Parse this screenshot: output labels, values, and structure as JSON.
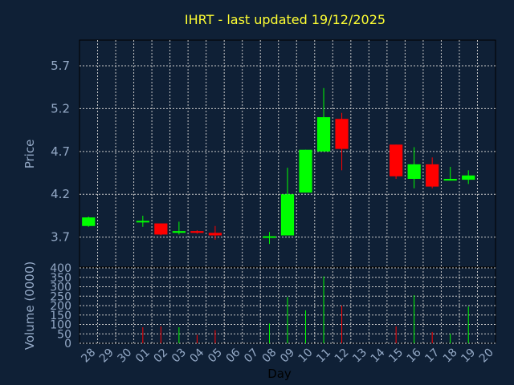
{
  "title": "IHRT - last updated 19/12/2025",
  "colors": {
    "background": "#0f2036",
    "plot_background": "#0f2036",
    "grid": "#c8c8c8",
    "up": "#00ff00",
    "down": "#ff0000",
    "title": "#ffff33",
    "labels": "#94a9c6"
  },
  "chart_data": [
    {
      "type": "candlestick",
      "title": "IHRT - last updated 19/12/2025",
      "ylabel": "Price",
      "xlabel": "",
      "ylim": [
        3.35,
        6.0
      ],
      "yticks": [
        3.7,
        4.2,
        4.7,
        5.2,
        5.7
      ],
      "ytick_labels": [
        "3.7",
        "4.2",
        "4.7",
        "5.2",
        "5.7"
      ],
      "grid": true,
      "categories": [
        "28",
        "29",
        "30",
        "01",
        "02",
        "03",
        "04",
        "05",
        "06",
        "07",
        "08",
        "09",
        "10",
        "11",
        "12",
        "13",
        "14",
        "15",
        "16",
        "17",
        "18",
        "19",
        "20"
      ],
      "series": [
        {
          "candles": [
            {
              "day": "28",
              "open": 3.83,
              "close": 3.93,
              "high": 3.94,
              "low": 3.82
            },
            {
              "day": "01",
              "open": 3.89,
              "close": 3.89,
              "high": 3.95,
              "low": 3.82
            },
            {
              "day": "02",
              "open": 3.86,
              "close": 3.73,
              "high": 3.86,
              "low": 3.72
            },
            {
              "day": "03",
              "open": 3.75,
              "close": 3.77,
              "high": 3.88,
              "low": 3.73
            },
            {
              "day": "04",
              "open": 3.77,
              "close": 3.75,
              "high": 3.78,
              "low": 3.74
            },
            {
              "day": "05",
              "open": 3.75,
              "close": 3.72,
              "high": 3.83,
              "low": 3.67
            },
            {
              "day": "08",
              "open": 3.7,
              "close": 3.71,
              "high": 3.76,
              "low": 3.62
            },
            {
              "day": "09",
              "open": 3.72,
              "close": 4.2,
              "high": 4.51,
              "low": 3.72
            },
            {
              "day": "10",
              "open": 4.22,
              "close": 4.72,
              "high": 4.72,
              "low": 4.22
            },
            {
              "day": "11",
              "open": 4.7,
              "close": 5.1,
              "high": 5.44,
              "low": 4.7
            },
            {
              "day": "12",
              "open": 5.08,
              "close": 4.73,
              "high": 5.15,
              "low": 4.48
            },
            {
              "day": "15",
              "open": 4.78,
              "close": 4.41,
              "high": 4.78,
              "low": 4.38
            },
            {
              "day": "16",
              "open": 4.38,
              "close": 4.55,
              "high": 4.75,
              "low": 4.27
            },
            {
              "day": "17",
              "open": 4.55,
              "close": 4.29,
              "high": 4.63,
              "low": 4.27
            },
            {
              "day": "18",
              "open": 4.36,
              "close": 4.38,
              "high": 4.52,
              "low": 4.36
            },
            {
              "day": "19",
              "open": 4.37,
              "close": 4.42,
              "high": 4.48,
              "low": 4.32
            }
          ]
        }
      ]
    },
    {
      "type": "bar",
      "ylabel": "Volume (0000)",
      "xlabel": "Day",
      "ylim": [
        0,
        400
      ],
      "yticks": [
        0,
        50,
        100,
        150,
        200,
        250,
        300,
        350,
        400
      ],
      "ytick_labels": [
        "0",
        "50",
        "100",
        "150",
        "200",
        "250",
        "300",
        "350",
        "400"
      ],
      "grid": true,
      "categories": [
        "28",
        "29",
        "30",
        "01",
        "02",
        "03",
        "04",
        "05",
        "06",
        "07",
        "08",
        "09",
        "10",
        "11",
        "12",
        "13",
        "14",
        "15",
        "16",
        "17",
        "18",
        "19",
        "20"
      ],
      "series": [
        {
          "bars": [
            {
              "day": "01",
              "value": 85,
              "direction": "down"
            },
            {
              "day": "02",
              "value": 90,
              "direction": "down"
            },
            {
              "day": "03",
              "value": 85,
              "direction": "up"
            },
            {
              "day": "04",
              "value": 45,
              "direction": "down"
            },
            {
              "day": "05",
              "value": 70,
              "direction": "down"
            },
            {
              "day": "08",
              "value": 105,
              "direction": "up"
            },
            {
              "day": "09",
              "value": 245,
              "direction": "up"
            },
            {
              "day": "10",
              "value": 175,
              "direction": "up"
            },
            {
              "day": "11",
              "value": 355,
              "direction": "up"
            },
            {
              "day": "12",
              "value": 200,
              "direction": "down"
            },
            {
              "day": "15",
              "value": 90,
              "direction": "down"
            },
            {
              "day": "16",
              "value": 255,
              "direction": "up"
            },
            {
              "day": "17",
              "value": 60,
              "direction": "down"
            },
            {
              "day": "18",
              "value": 50,
              "direction": "up"
            },
            {
              "day": "19",
              "value": 195,
              "direction": "up"
            }
          ]
        }
      ]
    }
  ]
}
